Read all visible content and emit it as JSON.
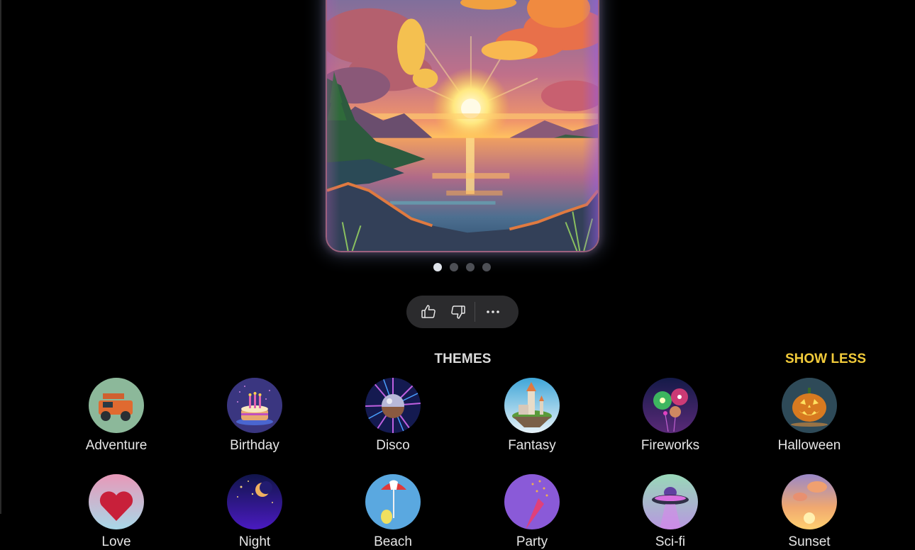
{
  "image_carousel": {
    "image_alt": "Cartoon sunset over a lake with mountains, clouds and pine trees",
    "slides": [
      {
        "label": "Image 1",
        "active": true
      },
      {
        "label": "Image 2",
        "active": false
      },
      {
        "label": "Image 3",
        "active": false
      },
      {
        "label": "Image 4",
        "active": false
      }
    ]
  },
  "feedback": {
    "like_icon": "thumbs-up-icon",
    "dislike_icon": "thumbs-down-icon",
    "more_icon": "more-horizontal-icon",
    "like_label": "Like",
    "dislike_label": "Dislike",
    "more_label": "More options"
  },
  "themes": {
    "title": "THEMES",
    "toggle_label": "SHOW LESS",
    "accent_color": "#f2cb3a",
    "items": [
      {
        "label": "Adventure"
      },
      {
        "label": "Birthday"
      },
      {
        "label": "Disco"
      },
      {
        "label": "Fantasy"
      },
      {
        "label": "Fireworks"
      },
      {
        "label": "Halloween"
      },
      {
        "label": "Love"
      },
      {
        "label": "Night"
      },
      {
        "label": "Beach"
      },
      {
        "label": "Party"
      },
      {
        "label": "Sci-fi"
      },
      {
        "label": "Sunset"
      }
    ]
  }
}
